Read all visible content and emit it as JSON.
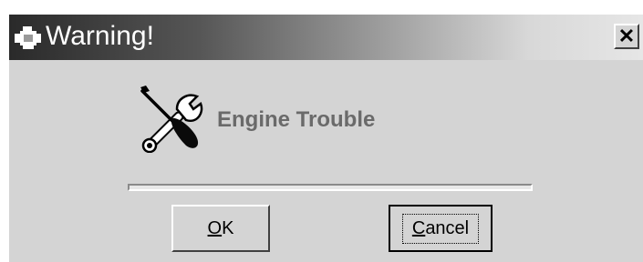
{
  "window": {
    "title": "Warning!",
    "close_label": "✕",
    "title_icon": "engine-icon"
  },
  "message": {
    "icon": "tools-icon",
    "text": "Engine Trouble"
  },
  "progress": {
    "value": 0
  },
  "buttons": {
    "ok": {
      "accel": "O",
      "rest": "K"
    },
    "cancel": {
      "accel": "C",
      "rest": "ancel"
    }
  },
  "colors": {
    "dialog_bg": "#d4d4d4",
    "title_gradient_start": "#2a2a2a",
    "title_gradient_end": "#e6e6e6",
    "message_text": "#6a6a6a"
  }
}
